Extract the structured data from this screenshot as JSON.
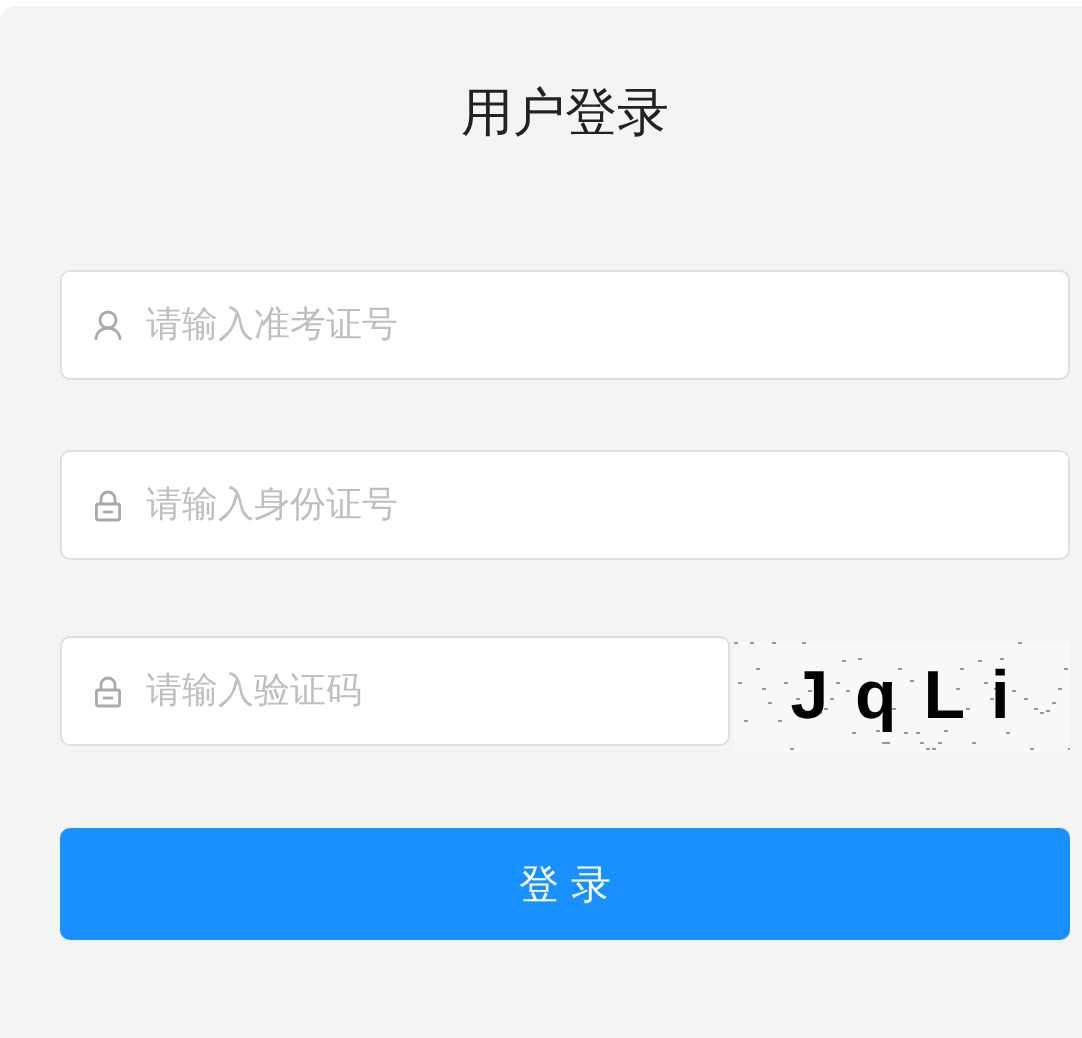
{
  "title": "用户登录",
  "fields": [
    {
      "kind": "user",
      "placeholder": "请输入准考证号"
    },
    {
      "kind": "lock",
      "placeholder": "请输入身份证号"
    }
  ],
  "captcha": {
    "kind": "lock",
    "placeholder": "请输入验证码",
    "code": "J q L i"
  },
  "button": "登 录"
}
